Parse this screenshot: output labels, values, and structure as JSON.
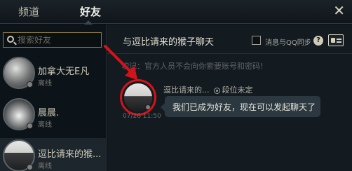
{
  "tabs": {
    "channels_label": "频道",
    "friends_label": "好友",
    "close_glyph": "✕"
  },
  "search": {
    "placeholder": "搜索好友"
  },
  "friends": [
    {
      "name": "加拿大无E凡",
      "status": "离线"
    },
    {
      "name": "晨晨.",
      "status": "离线"
    },
    {
      "name": "逗比请来的猴...",
      "status": "离线"
    }
  ],
  "chat": {
    "title": "与逗比请来的猴子聊天",
    "sync_label": "消息与QQ同步",
    "help_glyph": "?",
    "warning": "切记：官方人员不会向你索要账号和密码!",
    "message": {
      "sender": "逗比请来的...",
      "rank": "段位未定",
      "timestamp": "07/26 11:50",
      "text": "我们已成为好友，现在可以发起聊天了"
    }
  },
  "colors": {
    "accent_highlight": "#d2141a",
    "background": "#0a1016",
    "search_border": "#8c7a3e"
  }
}
